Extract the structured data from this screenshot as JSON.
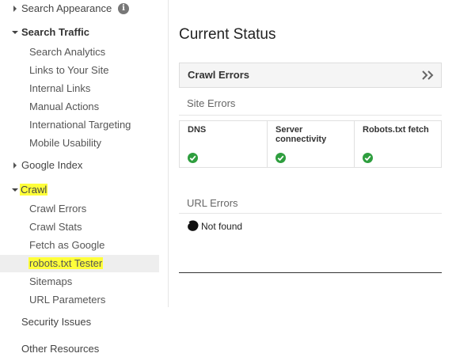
{
  "sidebar": {
    "search_appearance": "Search Appearance",
    "search_traffic": {
      "label": "Search Traffic",
      "items": [
        "Search Analytics",
        "Links to Your Site",
        "Internal Links",
        "Manual Actions",
        "International Targeting",
        "Mobile Usability"
      ]
    },
    "google_index": "Google Index",
    "crawl": {
      "label": "Crawl",
      "items": [
        "Crawl Errors",
        "Crawl Stats",
        "Fetch as Google",
        "robots.txt Tester",
        "Sitemaps",
        "URL Parameters"
      ]
    },
    "security_issues": "Security Issues",
    "other_resources": "Other Resources"
  },
  "main": {
    "title": "Current Status",
    "crawl_errors_title": "Crawl Errors",
    "site_errors_label": "Site Errors",
    "site_error_cells": [
      {
        "label": "DNS",
        "status": "ok"
      },
      {
        "label": "Server connectivity",
        "status": "ok"
      },
      {
        "label": "Robots.txt fetch",
        "status": "ok"
      }
    ],
    "url_errors_label": "URL Errors",
    "url_error_item": "Not found"
  },
  "colors": {
    "highlight": "#ffff3a",
    "check_green": "#2e9e3e",
    "selected_row": "#eeeeee"
  },
  "icons": {
    "info": "info-icon",
    "expand": "double-chevron-right-icon",
    "ok": "green-check-icon",
    "redacted": "scribble-icon"
  }
}
